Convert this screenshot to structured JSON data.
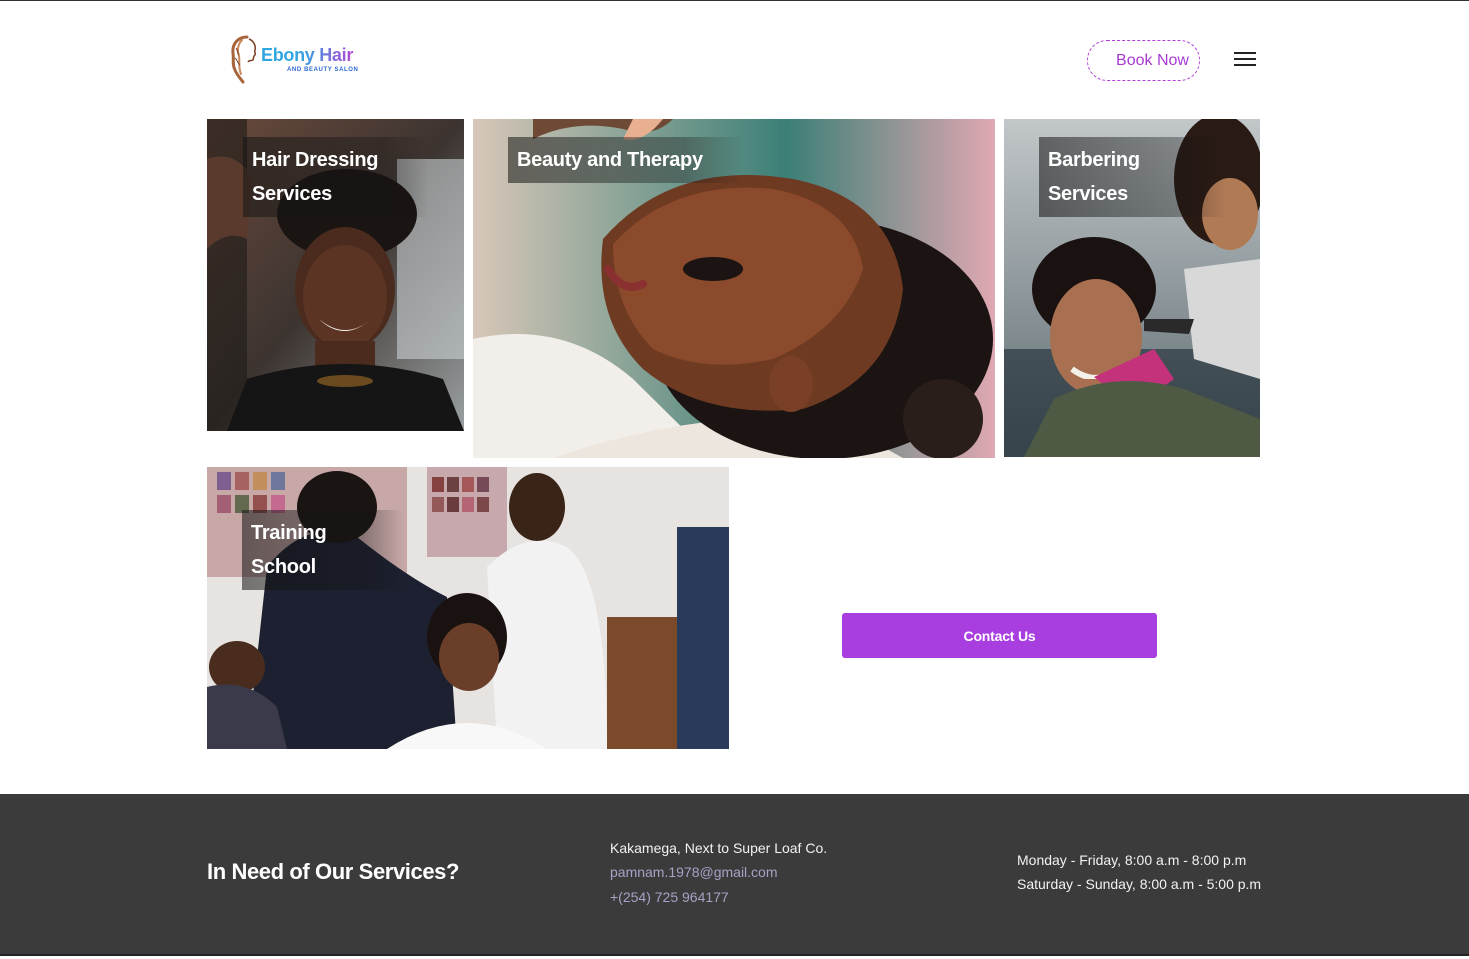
{
  "brand": {
    "name": "Ebony Hair",
    "tagline": "AND BEAUTY SALON"
  },
  "header": {
    "book_label": "Book Now",
    "menu_icon": "hamburger-menu-icon"
  },
  "services": [
    {
      "title_line1": "Hair Dressing",
      "title_line2": "Services"
    },
    {
      "title_line1": "Beauty and Therapy"
    },
    {
      "title_line1": "Barbering",
      "title_line2": "Services"
    },
    {
      "title_line1": "Training School"
    }
  ],
  "contact": {
    "button_label": "Contact Us"
  },
  "footer": {
    "title": "In Need of Our Services?",
    "address": "Kakamega, Next to Super Loaf Co.",
    "email": "pamnam.1978@gmail.com",
    "phone": "+(254) 725 964177",
    "hours_weekday": "Monday - Friday, 8:00 a.m - 8:00 p.m",
    "hours_weekend": "Saturday - Sunday, 8:00 a.m - 5:00 p.m"
  },
  "colors": {
    "accent": "#a93ee0",
    "footer_bg": "#3b3b3b",
    "link": "#a9a0c4"
  }
}
